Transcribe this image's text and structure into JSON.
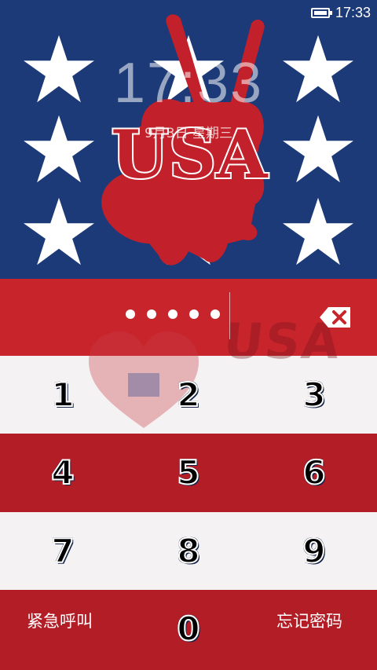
{
  "status_bar": {
    "time": "17:33",
    "battery_icon": "battery-icon"
  },
  "lock_clock": {
    "time": "17:33",
    "date": "9月3日 星期三"
  },
  "wallpaper": {
    "logo_text": "USA",
    "watermark_text": "USA"
  },
  "pin": {
    "entered_count": 5,
    "backspace_icon": "backspace-icon"
  },
  "keypad": {
    "k1": "1",
    "k2": "2",
    "k3": "3",
    "k4": "4",
    "k5": "5",
    "k6": "6",
    "k7": "7",
    "k8": "8",
    "k9": "9",
    "k0": "0"
  },
  "actions": {
    "emergency_call": "紧急呼叫",
    "forgot_password": "忘记密码"
  },
  "colors": {
    "navy": "#1c3a78",
    "red": "#b31d25",
    "white": "#f4f2f2"
  }
}
